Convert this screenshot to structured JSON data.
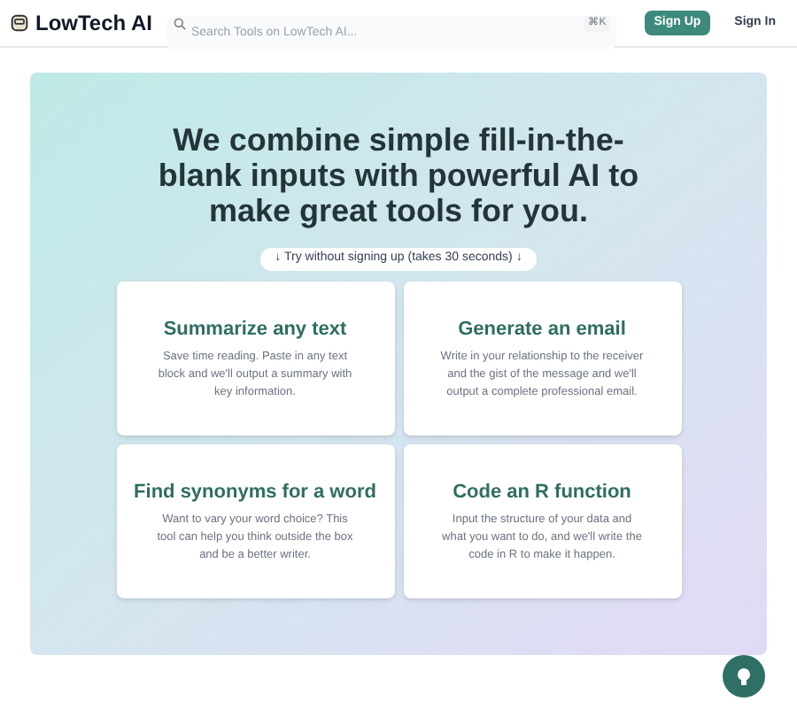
{
  "header": {
    "logo": "LowTech AI",
    "search": {
      "placeholder": "Search Tools on LowTech AI...",
      "shortcut": "⌘K"
    },
    "sign_up": "Sign Up",
    "sign_in": "Sign In"
  },
  "hero": {
    "headline": "We combine simple fill-in-the-blank inputs with powerful AI to make great tools for you.",
    "try_button": "↓ Try without signing up (takes 30 seconds) ↓"
  },
  "tools": [
    {
      "title": "Summarize any text",
      "description": "Save time reading. Paste in any text block and we'll output a summary with key information."
    },
    {
      "title": "Generate an email",
      "description": "Write in your relationship to the receiver and the gist of the message and we'll output a complete professional email."
    },
    {
      "title": "Find synonyms for a word",
      "description": "Want to vary your word choice? This tool can help you think outside the box and be a better writer."
    },
    {
      "title": "Code an R function",
      "description": "Input the structure of your data and what you want to do, and we'll write the code in R to make it happen."
    }
  ]
}
